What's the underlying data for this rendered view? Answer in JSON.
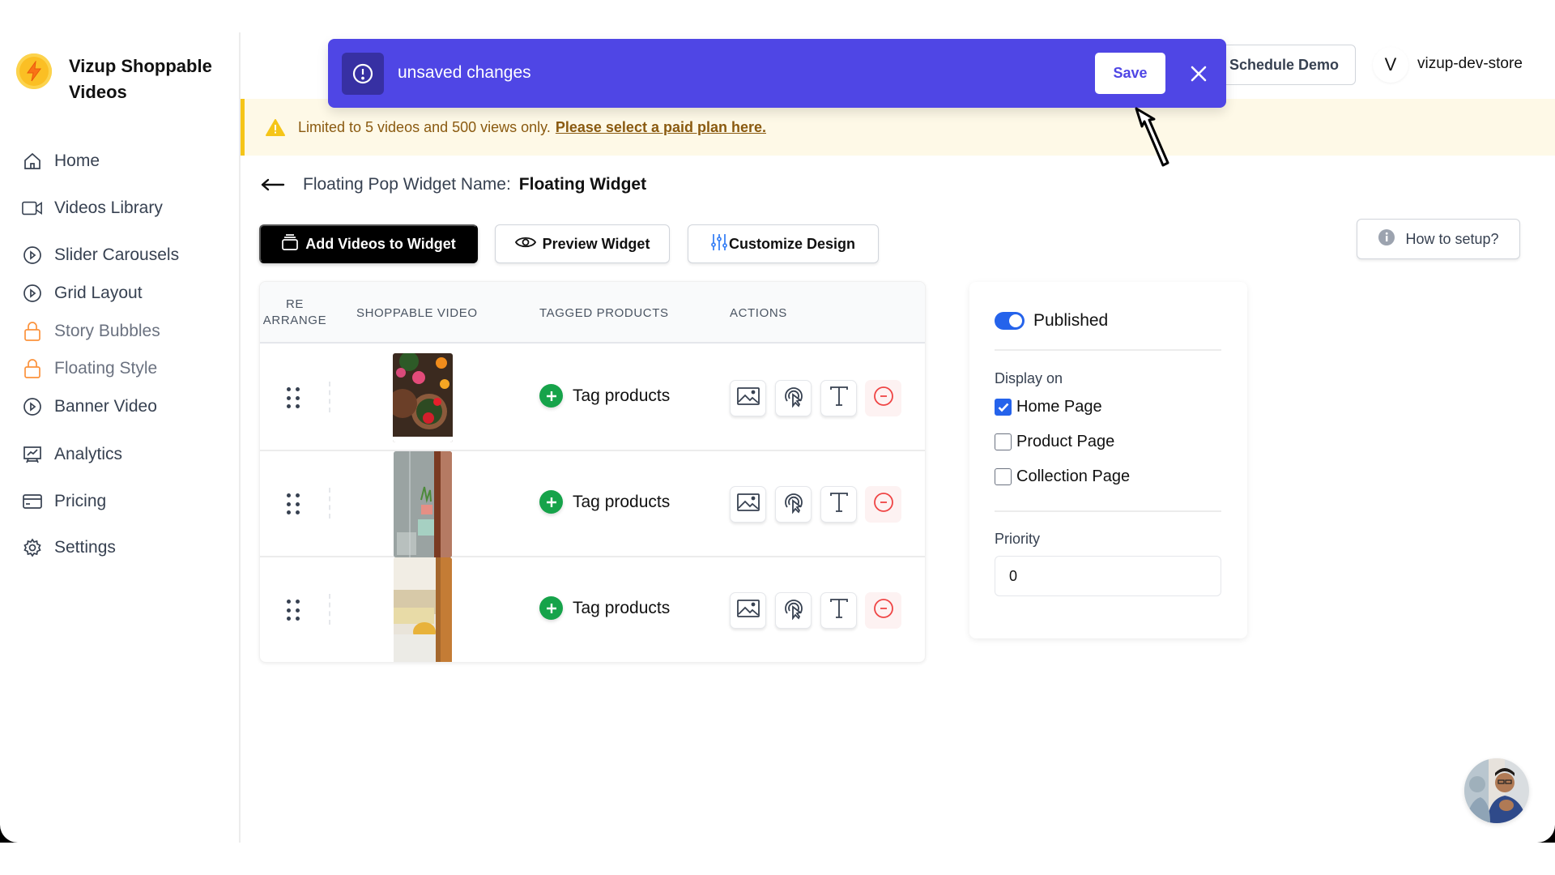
{
  "app": {
    "brand_name": "Vizup Shoppable Videos",
    "brand_color": "#fbbf24"
  },
  "sidebar": {
    "items": [
      {
        "label": "Home",
        "icon": "home-icon",
        "locked": false
      },
      {
        "label": "Videos Library",
        "icon": "video-camera-icon",
        "locked": false
      },
      {
        "label": "Slider Carousels",
        "icon": "play-circle-icon",
        "locked": false
      },
      {
        "label": "Grid Layout",
        "icon": "play-circle-icon",
        "locked": false
      },
      {
        "label": "Story Bubbles",
        "icon": "lock-icon",
        "locked": true
      },
      {
        "label": "Floating Style",
        "icon": "lock-icon",
        "locked": true
      },
      {
        "label": "Banner Video",
        "icon": "play-circle-icon",
        "locked": false
      },
      {
        "label": "Analytics",
        "icon": "presentation-chart-icon",
        "locked": false
      },
      {
        "label": "Pricing",
        "icon": "credit-card-icon",
        "locked": false
      },
      {
        "label": "Settings",
        "icon": "gear-icon",
        "locked": false
      }
    ]
  },
  "header": {
    "schedule_demo_label": "Schedule Demo",
    "store_initial": "V",
    "store_name": "vizup-dev-store"
  },
  "toast": {
    "message": "unsaved changes",
    "save_label": "Save",
    "color": "#4f46e5"
  },
  "banner": {
    "text": "Limited to 5 videos and 500 views only.",
    "link_text": "Please select a paid plan here."
  },
  "page": {
    "title_label": "Floating Pop Widget Name:",
    "title_value": "Floating Widget"
  },
  "toolbar": {
    "add_videos_label": "Add Videos to Widget",
    "preview_label": "Preview Widget",
    "customize_label": "Customize Design",
    "how_to_label": "How to setup?"
  },
  "table": {
    "headers": {
      "rearrange_line1": "RE",
      "rearrange_line2": "ARRANGE",
      "video": "SHOPPABLE VIDEO",
      "tagged": "TAGGED PRODUCTS",
      "actions": "ACTIONS"
    },
    "rows": [
      {
        "thumbnail": "flower-pots",
        "tag_label": "Tag products"
      },
      {
        "thumbnail": "bathroom-shower",
        "tag_label": "Tag products"
      },
      {
        "thumbnail": "living-room",
        "tag_label": "Tag products"
      }
    ]
  },
  "settings_panel": {
    "published_label": "Published",
    "published": true,
    "display_on_label": "Display on",
    "display_options": [
      {
        "label": "Home Page",
        "checked": true
      },
      {
        "label": "Product Page",
        "checked": false
      },
      {
        "label": "Collection Page",
        "checked": false
      }
    ],
    "priority_label": "Priority",
    "priority_value": "0"
  }
}
